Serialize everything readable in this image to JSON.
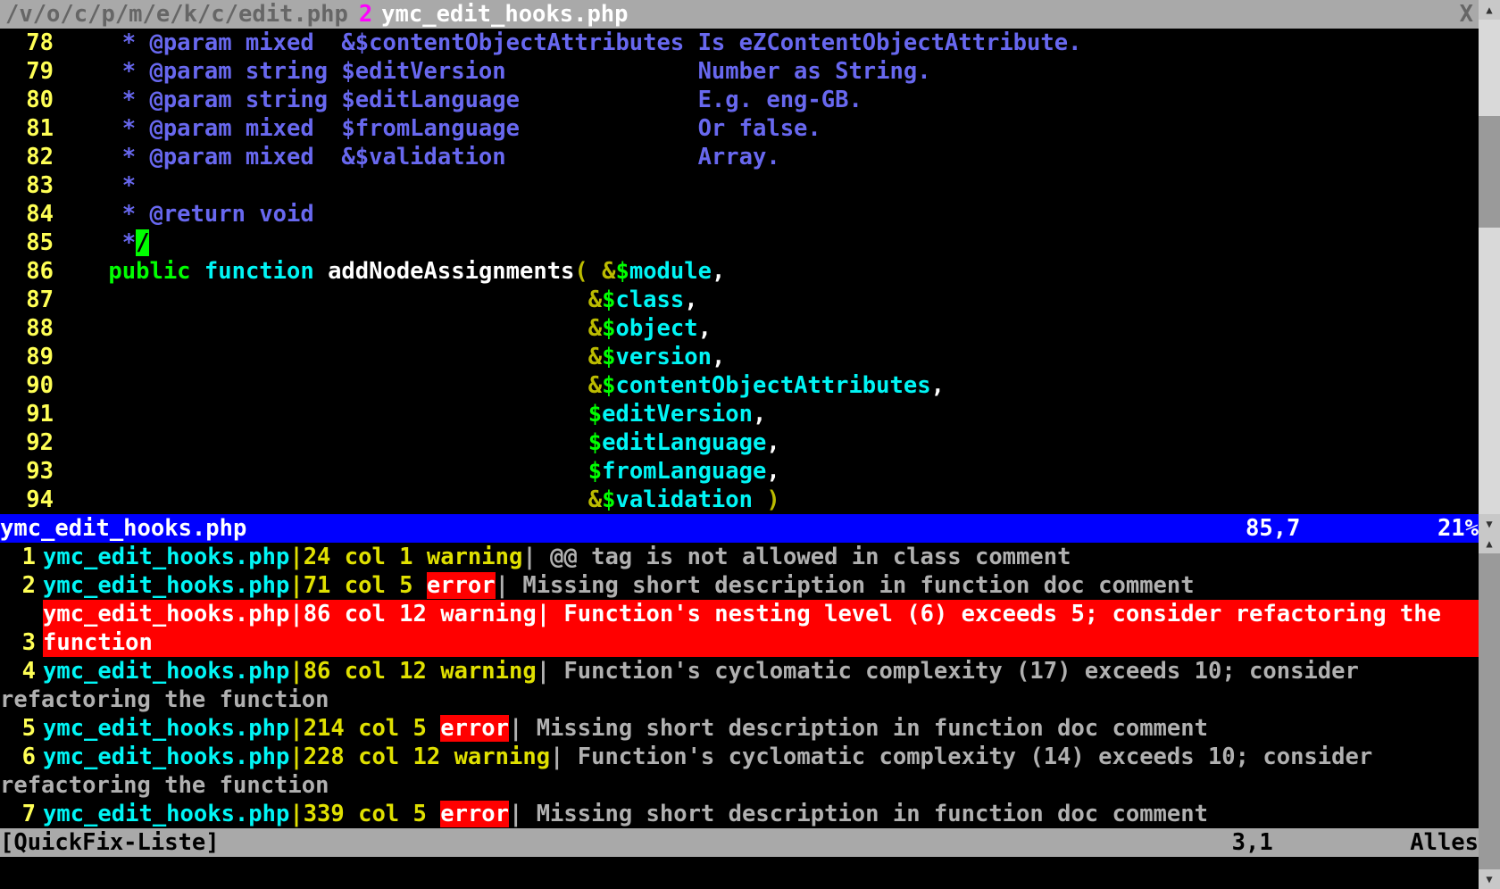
{
  "tabs": {
    "inactive_label": "/v/o/c/p/m/e/k/c/edit.php",
    "active_num": "2",
    "active_label": "ymc_edit_hooks.php",
    "close_glyph": "X"
  },
  "code": {
    "l78": {
      "n": "78",
      "a": "     * ",
      "b": "@param mixed  ",
      "c": "&$contentObjectAttributes ",
      "d": "Is eZContentObjectAttribute."
    },
    "l79": {
      "n": "79",
      "a": "     * ",
      "b": "@param string ",
      "c": "$editVersion              ",
      "d": "Number as String."
    },
    "l80": {
      "n": "80",
      "a": "     * ",
      "b": "@param string ",
      "c": "$editLanguage             ",
      "d": "E.g. eng-GB."
    },
    "l81": {
      "n": "81",
      "a": "     * ",
      "b": "@param mixed  ",
      "c": "$fromLanguage             ",
      "d": "Or false."
    },
    "l82": {
      "n": "82",
      "a": "     * ",
      "b": "@param mixed  ",
      "c": "&$validation              ",
      "d": "Array."
    },
    "l83": {
      "n": "83",
      "a": "     *"
    },
    "l84": {
      "n": "84",
      "a": "     * ",
      "b": "@return void"
    },
    "l85": {
      "n": "85",
      "a": "     *",
      "cur": "/"
    },
    "l86": {
      "n": "86",
      "pub": "    public ",
      "fn": "function ",
      "name": "addNodeAssignments",
      "open": "( ",
      "amp": "&",
      "sig": "$",
      "var": "module",
      "tail": ","
    },
    "argrows": [
      {
        "n": "87",
        "pad": "                                       ",
        "amp": "&",
        "sig": "$",
        "var": "class",
        "tail": ","
      },
      {
        "n": "88",
        "pad": "                                       ",
        "amp": "&",
        "sig": "$",
        "var": "object",
        "tail": ","
      },
      {
        "n": "89",
        "pad": "                                       ",
        "amp": "&",
        "sig": "$",
        "var": "version",
        "tail": ","
      },
      {
        "n": "90",
        "pad": "                                       ",
        "amp": "&",
        "sig": "$",
        "var": "contentObjectAttributes",
        "tail": ","
      },
      {
        "n": "91",
        "pad": "                                       ",
        "amp": "",
        "sig": "$",
        "var": "editVersion",
        "tail": ","
      },
      {
        "n": "92",
        "pad": "                                       ",
        "amp": "",
        "sig": "$",
        "var": "editLanguage",
        "tail": ","
      },
      {
        "n": "93",
        "pad": "                                       ",
        "amp": "",
        "sig": "$",
        "var": "fromLanguage",
        "tail": ","
      },
      {
        "n": "94",
        "pad": "                                       ",
        "amp": "&",
        "sig": "$",
        "var": "validation",
        "tail": " ",
        "close": ")"
      }
    ]
  },
  "status_main": {
    "file": "ymc_edit_hooks.php",
    "pos": "85,7",
    "pct": "21%"
  },
  "quickfix": [
    {
      "n": "1",
      "file": "ymc_edit_hooks.php",
      "loc": "|24 col 1 ",
      "sev": "warning",
      "sevtype": "warn",
      "msg": "| @@ tag is not allowed in class comment",
      "sel": false
    },
    {
      "n": "2",
      "file": "ymc_edit_hooks.php",
      "loc": "|71 col 5 ",
      "sev": "error",
      "sevtype": "err",
      "msg": "| Missing short description in function doc comment",
      "sel": false
    },
    {
      "n": "3",
      "file": "ymc_edit_hooks.php",
      "loc": "|86 col 12 ",
      "sev": "warning",
      "sevtype": "warn",
      "msg": "| Function's nesting level (6) exceeds 5; consider refactoring the function",
      "sel": true
    },
    {
      "n": "4",
      "file": "ymc_edit_hooks.php",
      "loc": "|86 col 12 ",
      "sev": "warning",
      "sevtype": "warn",
      "msg": "| Function's cyclomatic complexity (17) exceeds 10; consider refactoring the function",
      "sel": false
    },
    {
      "n": "5",
      "file": "ymc_edit_hooks.php",
      "loc": "|214 col 5 ",
      "sev": "error",
      "sevtype": "err",
      "msg": "| Missing short description in function doc comment",
      "sel": false
    },
    {
      "n": "6",
      "file": "ymc_edit_hooks.php",
      "loc": "|228 col 12 ",
      "sev": "warning",
      "sevtype": "warn",
      "msg": "| Function's cyclomatic complexity (14) exceeds 10; consider refactoring the function",
      "sel": false
    },
    {
      "n": "7",
      "file": "ymc_edit_hooks.php",
      "loc": "|339 col 5 ",
      "sev": "error",
      "sevtype": "err",
      "msg": "| Missing short description in function doc comment",
      "sel": false
    }
  ],
  "status_qf": {
    "label": "[QuickFix-Liste]",
    "pos": "3,1",
    "pct": "Alles"
  }
}
